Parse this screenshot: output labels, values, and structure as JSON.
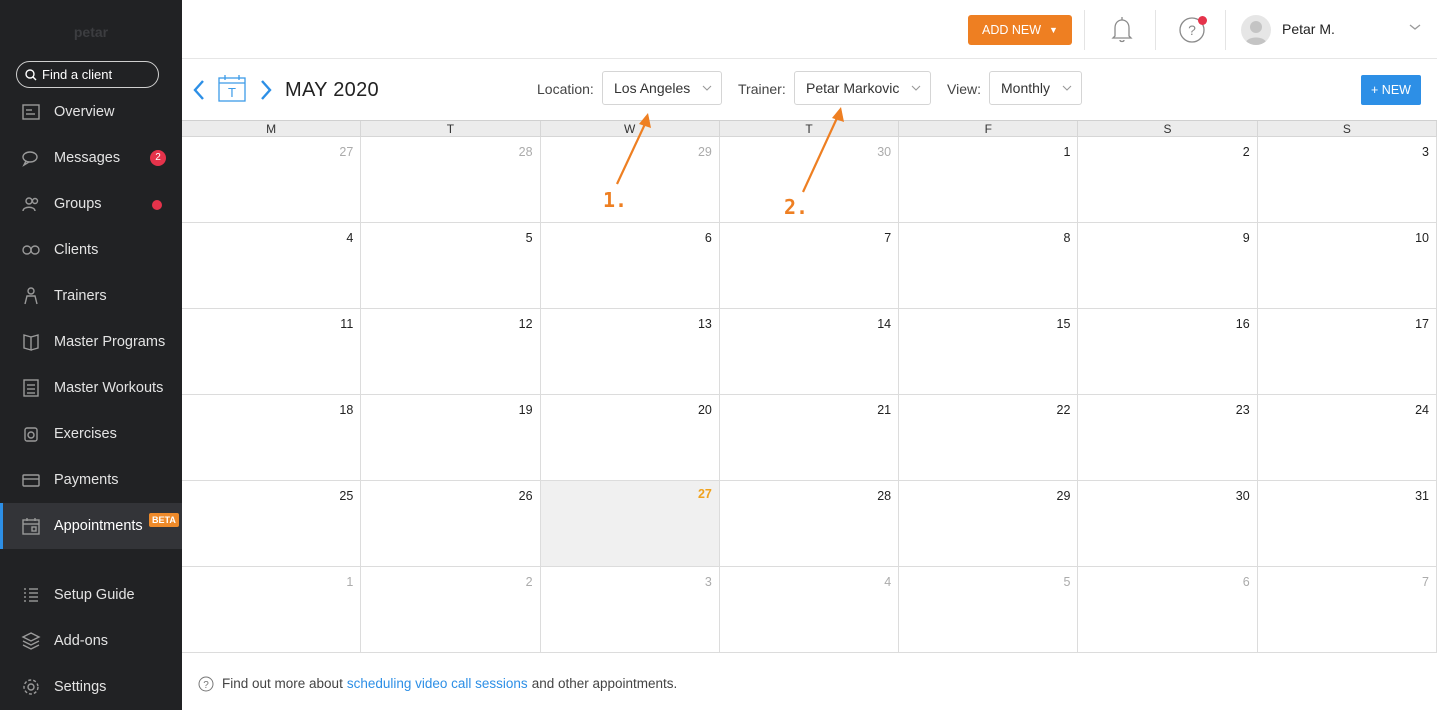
{
  "sidebar": {
    "brand": "petar",
    "search_label": "Find a client",
    "items": [
      {
        "label": "Overview",
        "icon": "overview-icon"
      },
      {
        "label": "Messages",
        "icon": "messages-icon",
        "badge": "2"
      },
      {
        "label": "Groups",
        "icon": "groups-icon",
        "dot": true
      },
      {
        "label": "Clients",
        "icon": "clients-icon"
      },
      {
        "label": "Trainers",
        "icon": "trainers-icon"
      },
      {
        "label": "Master Programs",
        "icon": "master-programs-icon"
      },
      {
        "label": "Master Workouts",
        "icon": "master-workouts-icon"
      },
      {
        "label": "Exercises",
        "icon": "exercises-icon"
      },
      {
        "label": "Payments",
        "icon": "payments-icon"
      },
      {
        "label": "Appointments",
        "icon": "appointments-icon",
        "active": true,
        "tag": "BETA"
      },
      {
        "label": "Setup Guide",
        "icon": "setup-guide-icon"
      },
      {
        "label": "Add-ons",
        "icon": "add-ons-icon"
      },
      {
        "label": "Settings",
        "icon": "settings-icon"
      }
    ]
  },
  "topbar": {
    "add_new_label": "ADD NEW",
    "user_name": "Petar M."
  },
  "toolbar": {
    "calendar_icon_letter": "T",
    "month_title": "MAY 2020",
    "location_label": "Location:",
    "location_value": "Los Angeles",
    "trainer_label": "Trainer:",
    "trainer_value": "Petar Markovic",
    "view_label": "View:",
    "view_value": "Monthly",
    "new_label": "+ NEW"
  },
  "calendar": {
    "weekdays": [
      "M",
      "T",
      "W",
      "T",
      "F",
      "S",
      "S"
    ],
    "weeks": [
      [
        {
          "d": "27",
          "m": true
        },
        {
          "d": "28",
          "m": true
        },
        {
          "d": "29",
          "m": true
        },
        {
          "d": "30",
          "m": true
        },
        {
          "d": "1"
        },
        {
          "d": "2"
        },
        {
          "d": "3"
        }
      ],
      [
        {
          "d": "4"
        },
        {
          "d": "5"
        },
        {
          "d": "6"
        },
        {
          "d": "7"
        },
        {
          "d": "8"
        },
        {
          "d": "9"
        },
        {
          "d": "10"
        }
      ],
      [
        {
          "d": "11"
        },
        {
          "d": "12"
        },
        {
          "d": "13"
        },
        {
          "d": "14"
        },
        {
          "d": "15"
        },
        {
          "d": "16"
        },
        {
          "d": "17"
        }
      ],
      [
        {
          "d": "18"
        },
        {
          "d": "19"
        },
        {
          "d": "20"
        },
        {
          "d": "21"
        },
        {
          "d": "22"
        },
        {
          "d": "23"
        },
        {
          "d": "24"
        }
      ],
      [
        {
          "d": "25"
        },
        {
          "d": "26"
        },
        {
          "d": "27",
          "today": true
        },
        {
          "d": "28"
        },
        {
          "d": "29"
        },
        {
          "d": "30"
        },
        {
          "d": "31"
        }
      ],
      [
        {
          "d": "1",
          "m": true
        },
        {
          "d": "2",
          "m": true
        },
        {
          "d": "3",
          "m": true
        },
        {
          "d": "4",
          "m": true
        },
        {
          "d": "5",
          "m": true
        },
        {
          "d": "6",
          "m": true
        },
        {
          "d": "7",
          "m": true
        }
      ]
    ]
  },
  "annotations": {
    "one": "1.",
    "two": "2."
  },
  "footer": {
    "prefix": "Find out more about",
    "link": "scheduling video call sessions",
    "suffix": "and other appointments."
  },
  "colors": {
    "accent_orange": "#ee7f22",
    "accent_blue": "#2d8fe6",
    "sidebar_bg": "#212224",
    "badge_red": "#e5334b",
    "today_number": "#f0a21e"
  }
}
